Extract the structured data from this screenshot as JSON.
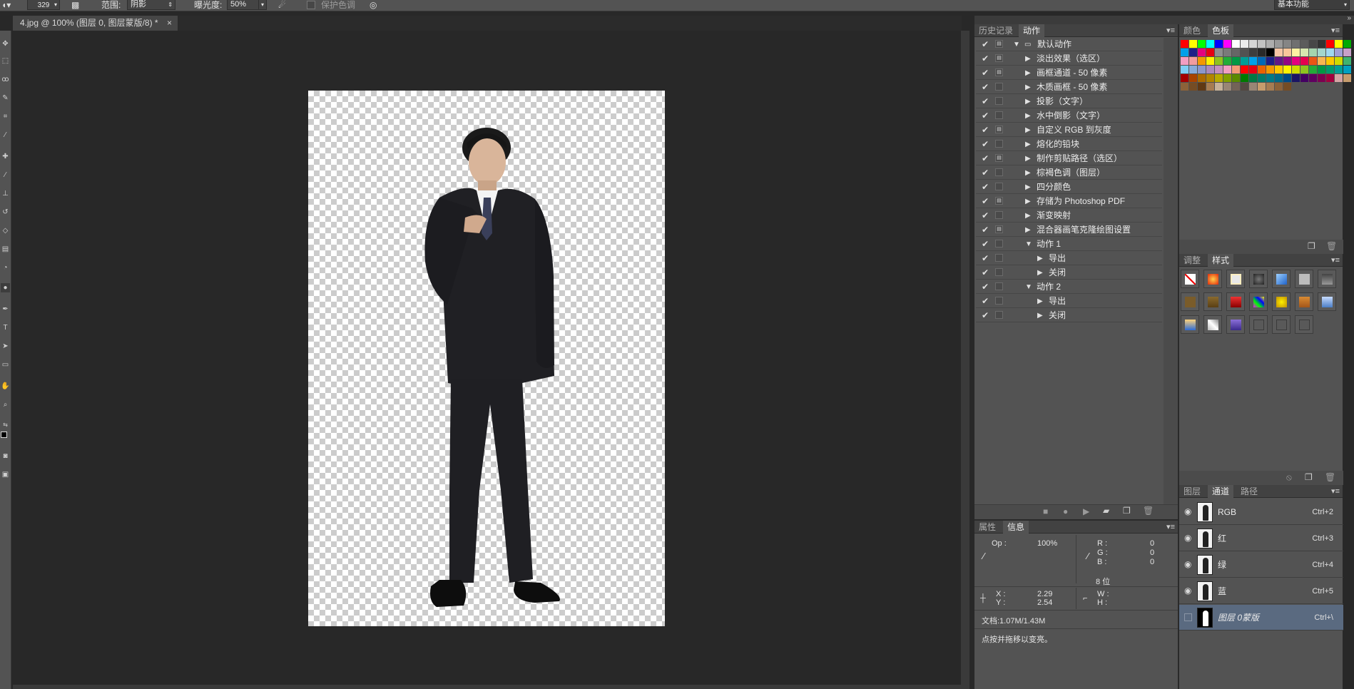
{
  "options_bar": {
    "brush_size": "329",
    "range_label": "范围:",
    "range_value": "阴影",
    "exposure_label": "曝光度:",
    "exposure_value": "50%",
    "protect_tones_label": "保护色调",
    "workspace": "基本功能"
  },
  "document_tab": {
    "title": "4.jpg @ 100% (图层 0, 图层蒙版/8) *",
    "close": "×"
  },
  "actions_panel": {
    "tabs": [
      "历史记录",
      "动作"
    ],
    "rows": [
      {
        "label": "默认动作",
        "indent": 0,
        "expanded": true,
        "dialog": true,
        "set": true
      },
      {
        "label": "淡出效果（选区）",
        "indent": 1,
        "expanded": false,
        "dialog": true
      },
      {
        "label": "画框通道 - 50 像素",
        "indent": 1,
        "expanded": false,
        "dialog": true
      },
      {
        "label": "木质画框 - 50 像素",
        "indent": 1,
        "expanded": false,
        "dialog": false
      },
      {
        "label": "投影（文字）",
        "indent": 1,
        "expanded": false,
        "dialog": false
      },
      {
        "label": "水中倒影（文字）",
        "indent": 1,
        "expanded": false,
        "dialog": false
      },
      {
        "label": "自定义 RGB 到灰度",
        "indent": 1,
        "expanded": false,
        "dialog": true
      },
      {
        "label": "熔化的铅块",
        "indent": 1,
        "expanded": false,
        "dialog": false
      },
      {
        "label": "制作剪贴路径（选区）",
        "indent": 1,
        "expanded": false,
        "dialog": true
      },
      {
        "label": "棕褐色调（图层）",
        "indent": 1,
        "expanded": false,
        "dialog": false
      },
      {
        "label": "四分颜色",
        "indent": 1,
        "expanded": false,
        "dialog": false
      },
      {
        "label": "存储为 Photoshop PDF",
        "indent": 1,
        "expanded": false,
        "dialog": true
      },
      {
        "label": "渐变映射",
        "indent": 1,
        "expanded": false,
        "dialog": false
      },
      {
        "label": "混合器画笔克隆绘图设置",
        "indent": 1,
        "expanded": false,
        "dialog": true
      },
      {
        "label": "动作 1",
        "indent": 1,
        "expanded": true,
        "dialog": false
      },
      {
        "label": "导出",
        "indent": 2,
        "expanded": false,
        "dialog": false
      },
      {
        "label": "关闭",
        "indent": 2,
        "expanded": false,
        "dialog": false
      },
      {
        "label": "动作 2",
        "indent": 1,
        "expanded": true,
        "dialog": false
      },
      {
        "label": "导出",
        "indent": 2,
        "expanded": false,
        "dialog": false
      },
      {
        "label": "关闭",
        "indent": 2,
        "expanded": false,
        "dialog": false
      }
    ]
  },
  "swatches_panel": {
    "tabs": [
      "颜色",
      "色板"
    ]
  },
  "styles_panel": {
    "tabs": [
      "调整",
      "样式"
    ]
  },
  "info_panel": {
    "tabs": [
      "属性",
      "信息"
    ],
    "op_label": "Op :",
    "op_value": "100%",
    "r_label": "R :",
    "r_value": "0",
    "g_label": "G :",
    "g_value": "0",
    "b_label": "B :",
    "b_value": "0",
    "bit_depth": "8 位",
    "x_label": "X :",
    "x_value": "2.29",
    "y_label": "Y :",
    "y_value": "2.54",
    "w_label": "W :",
    "h_label": "H :",
    "doc_size": "文档:1.07M/1.43M",
    "hint": "点按并拖移以变亮。"
  },
  "channels_panel": {
    "tabs": [
      "图层",
      "通道",
      "路径"
    ],
    "rows": [
      {
        "name": "RGB",
        "shortcut": "Ctrl+2",
        "visible": true
      },
      {
        "name": "红",
        "shortcut": "Ctrl+3",
        "visible": true
      },
      {
        "name": "绿",
        "shortcut": "Ctrl+4",
        "visible": true
      },
      {
        "name": "蓝",
        "shortcut": "Ctrl+5",
        "visible": true
      },
      {
        "name": "图层 0蒙版",
        "shortcut": "Ctrl+\\",
        "visible": false,
        "selected": true
      }
    ]
  },
  "colors": {
    "panel_bg": "#535353",
    "app_bg": "#282828",
    "selected_row": "#5a6a80",
    "action_tab_active": "#535353"
  }
}
